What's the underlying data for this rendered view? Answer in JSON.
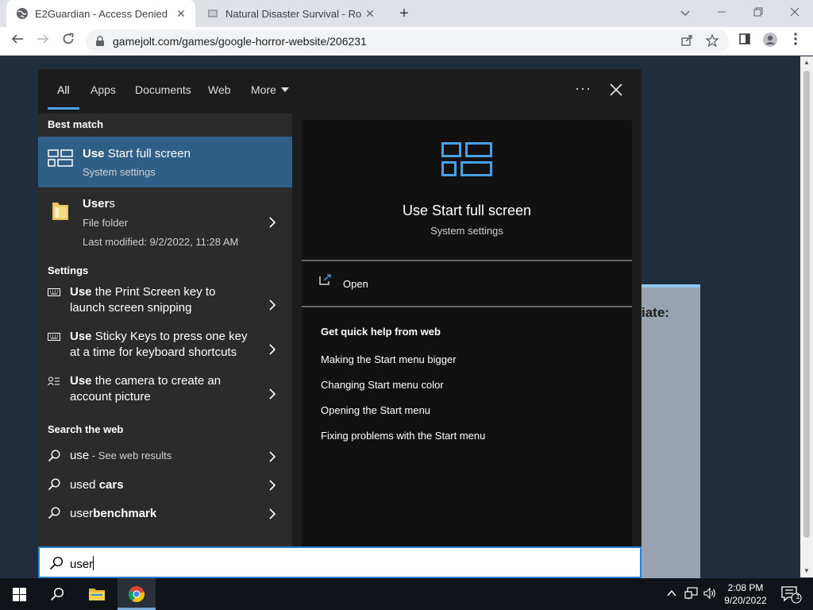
{
  "browser": {
    "tabs": [
      {
        "title": "E2Guardian - Access Denied",
        "close": "✕"
      },
      {
        "title": "Natural Disaster Survival - Roblox",
        "close": "✕"
      }
    ],
    "new_tab": "+",
    "url": "gamejolt.com/games/google-horror-website/206231"
  },
  "page": {
    "card_text": "iate:"
  },
  "search": {
    "scopes": [
      "All",
      "Apps",
      "Documents",
      "Web",
      "More"
    ],
    "ellipsis": "···",
    "sections": {
      "best_match": "Best match",
      "settings": "Settings",
      "web": "Search the web"
    },
    "best_match": {
      "title_bold": "Use",
      "title_rest": " Start full screen",
      "subtitle": "System settings"
    },
    "users_item": {
      "title_bold": "User",
      "title_rest": "s",
      "type": "File folder",
      "modified": "Last modified: 9/2/2022, 11:28 AM"
    },
    "settings_items": [
      {
        "bold": "Use",
        "line1": " the Print Screen key to",
        "line2": "launch screen snipping",
        "icon": "keyboard-icon"
      },
      {
        "bold": "Use",
        "line1": " Sticky Keys to press one key",
        "line2": "at a time for keyboard shortcuts",
        "icon": "keyboard-icon"
      },
      {
        "bold": "Use",
        "line1": " the camera to create an",
        "line2": "account picture",
        "icon": "account-picture-icon"
      }
    ],
    "web_items": [
      {
        "normal": "use",
        "suffix": " - See web results",
        "bold": ""
      },
      {
        "normal": "used",
        "suffix": "",
        "bold": " cars"
      },
      {
        "normal": "user",
        "suffix": "",
        "bold": "benchmark"
      }
    ],
    "preview": {
      "title": "Use Start full screen",
      "subtitle": "System settings",
      "open": "Open",
      "help_heading": "Get quick help from web",
      "links": [
        "Making the Start menu bigger",
        "Changing Start menu color",
        "Opening the Start menu",
        "Fixing problems with the Start menu"
      ]
    },
    "query": "user"
  },
  "taskbar": {
    "time": "2:08 PM",
    "date": "9/20/2022",
    "notification_count": "1"
  },
  "colors": {
    "accent": "#2f5f86",
    "search_border": "#2f7fd0",
    "icon_blue": "#4aa0e6"
  }
}
